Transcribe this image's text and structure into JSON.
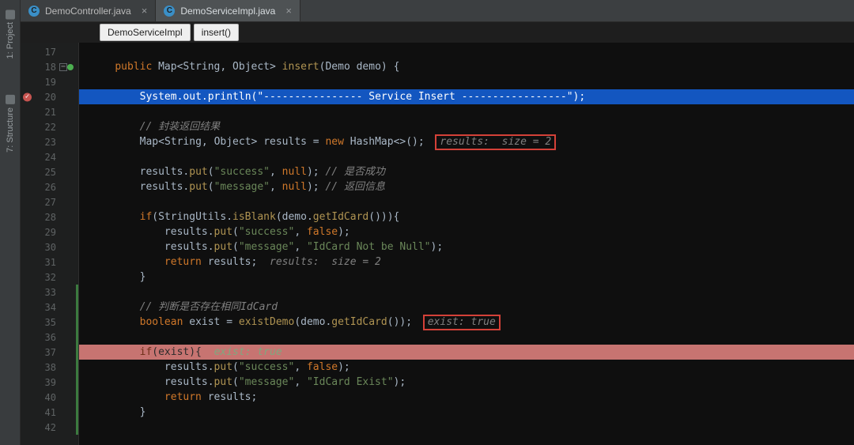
{
  "toolwindows": [
    {
      "label": "1: Project",
      "icon": "project-icon"
    },
    {
      "label": "7: Structure",
      "icon": "structure-icon"
    }
  ],
  "tabs": [
    {
      "label": "DemoController.java",
      "active": false
    },
    {
      "label": "DemoServiceImpl.java",
      "active": true
    }
  ],
  "breadcrumbs": [
    "DemoServiceImpl",
    "insert()"
  ],
  "gutter": {
    "start": 17,
    "end": 42,
    "ok_markers": [
      18
    ],
    "err_markers": [
      20
    ],
    "green_stripe_from": 33,
    "green_stripe_to": 42,
    "fold_at": 18
  },
  "code": {
    "l17": "",
    "l18": {
      "kw1": "public",
      "typ": "Map",
      "gen1": "String",
      "gen2": "Object",
      "method": "insert",
      "paramType": "Demo",
      "paramName": "demo"
    },
    "l19": "",
    "l20": {
      "call1": "System",
      "call2": "out",
      "fn": "println",
      "str": "\"---------------- Service Insert -----------------\""
    },
    "l21": "",
    "l22": {
      "cmt": "// 封装返回结果"
    },
    "l23": {
      "typ": "Map",
      "gen1": "String",
      "gen2": "Object",
      "var": "results",
      "kw": "new",
      "ctor": "HashMap",
      "hint": "results:  size = 2"
    },
    "l24": "",
    "l25": {
      "obj": "results",
      "fn": "put",
      "k": "\"success\"",
      "v": "null",
      "cmt": "// 是否成功"
    },
    "l26": {
      "obj": "results",
      "fn": "put",
      "k": "\"message\"",
      "v": "null",
      "cmt": "// 返回信息"
    },
    "l27": "",
    "l28": {
      "kw": "if",
      "cls": "StringUtils",
      "fn": "isBlank",
      "arg": "demo",
      "fn2": "getIdCard"
    },
    "l29": {
      "obj": "results",
      "fn": "put",
      "k": "\"success\"",
      "v": "false"
    },
    "l30": {
      "obj": "results",
      "fn": "put",
      "k": "\"message\"",
      "v": "\"IdCard Not be Null\""
    },
    "l31": {
      "kw": "return",
      "var": "results",
      "hint": "results:  size = 2"
    },
    "l32": {
      "brace": "}"
    },
    "l33": "",
    "l34": {
      "cmt": "// 判断是否存在相同IdCard"
    },
    "l35": {
      "kw": "boolean",
      "var": "exist",
      "fn": "existDemo",
      "arg": "demo",
      "fn2": "getIdCard",
      "hint": "exist: true"
    },
    "l36": "",
    "l37": {
      "kw": "if",
      "var": "exist",
      "hint": "exist: true"
    },
    "l38": {
      "obj": "results",
      "fn": "put",
      "k": "\"success\"",
      "v": "false"
    },
    "l39": {
      "obj": "results",
      "fn": "put",
      "k": "\"message\"",
      "v": "\"IdCard Exist\""
    },
    "l40": {
      "kw": "return",
      "var": "results"
    },
    "l41": {
      "brace": "}"
    },
    "l42": ""
  }
}
